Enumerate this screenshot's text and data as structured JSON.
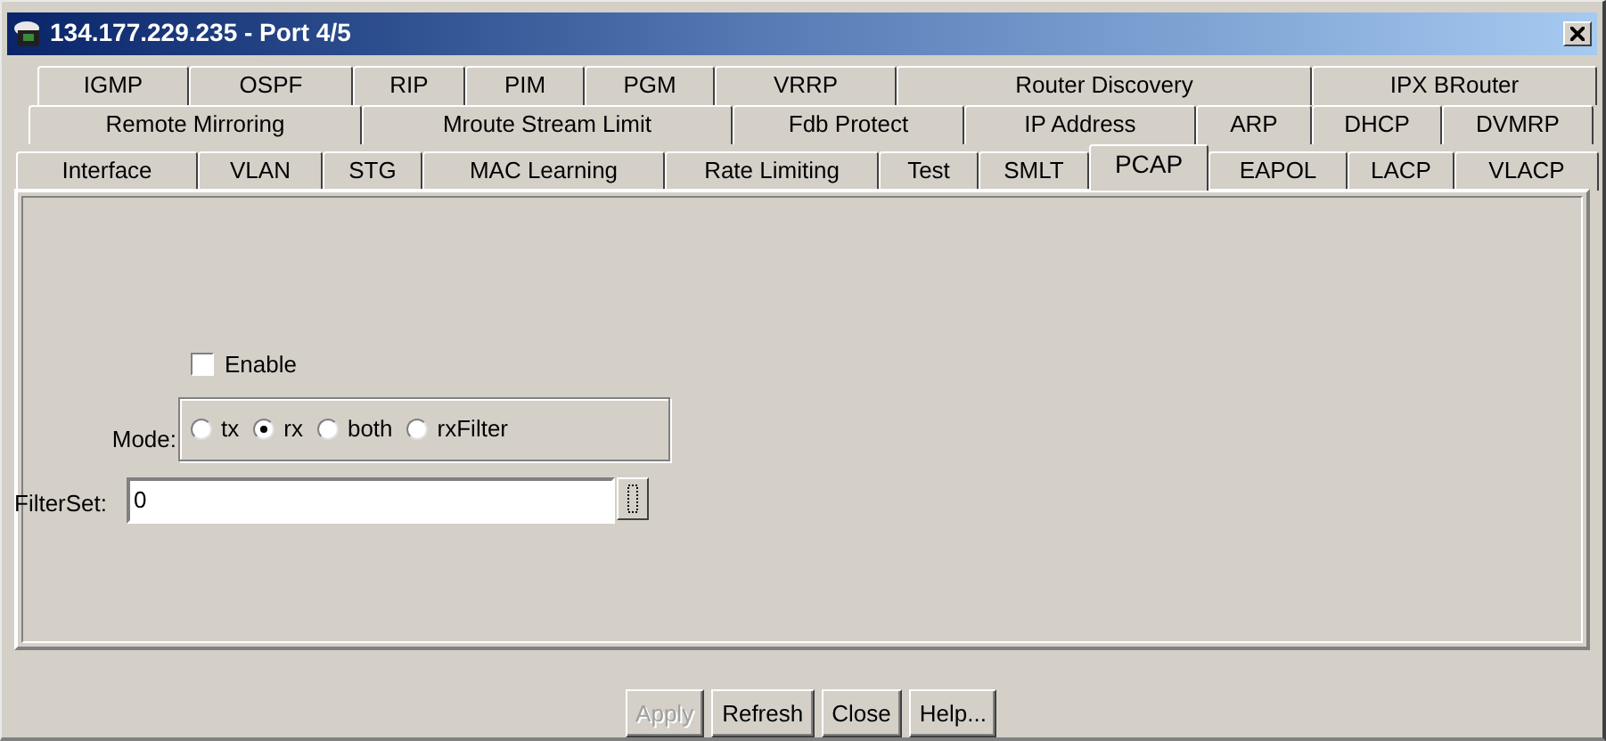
{
  "window": {
    "title": "134.177.229.235 - Port 4/5"
  },
  "tab_rows": [
    [
      {
        "label": "IGMP",
        "selected": false
      },
      {
        "label": "OSPF",
        "selected": false
      },
      {
        "label": "RIP",
        "selected": false
      },
      {
        "label": "PIM",
        "selected": false
      },
      {
        "label": "PGM",
        "selected": false
      },
      {
        "label": "VRRP",
        "selected": false
      },
      {
        "label": "Router Discovery",
        "selected": false
      },
      {
        "label": "IPX BRouter",
        "selected": false
      }
    ],
    [
      {
        "label": "Remote Mirroring",
        "selected": false
      },
      {
        "label": "Mroute Stream Limit",
        "selected": false
      },
      {
        "label": "Fdb Protect",
        "selected": false
      },
      {
        "label": "IP Address",
        "selected": false
      },
      {
        "label": "ARP",
        "selected": false
      },
      {
        "label": "DHCP",
        "selected": false
      },
      {
        "label": "DVMRP",
        "selected": false
      }
    ],
    [
      {
        "label": "Interface",
        "selected": false
      },
      {
        "label": "VLAN",
        "selected": false
      },
      {
        "label": "STG",
        "selected": false
      },
      {
        "label": "MAC Learning",
        "selected": false
      },
      {
        "label": "Rate Limiting",
        "selected": false
      },
      {
        "label": "Test",
        "selected": false
      },
      {
        "label": "SMLT",
        "selected": false
      },
      {
        "label": "PCAP",
        "selected": true
      },
      {
        "label": "EAPOL",
        "selected": false
      },
      {
        "label": "LACP",
        "selected": false
      },
      {
        "label": "VLACP",
        "selected": false
      }
    ]
  ],
  "enable": {
    "label": "Enable",
    "checked": false
  },
  "mode": {
    "label": "Mode:",
    "options": [
      {
        "label": "tx",
        "selected": false
      },
      {
        "label": "rx",
        "selected": true
      },
      {
        "label": "both",
        "selected": false
      },
      {
        "label": "rxFilter",
        "selected": false
      }
    ]
  },
  "filter_set": {
    "label": "FilterSet:",
    "value": "0"
  },
  "buttons": [
    {
      "label": "Apply",
      "disabled": true
    },
    {
      "label": "Refresh",
      "disabled": false
    },
    {
      "label": "Close",
      "disabled": false
    },
    {
      "label": "Help...",
      "disabled": false
    }
  ]
}
